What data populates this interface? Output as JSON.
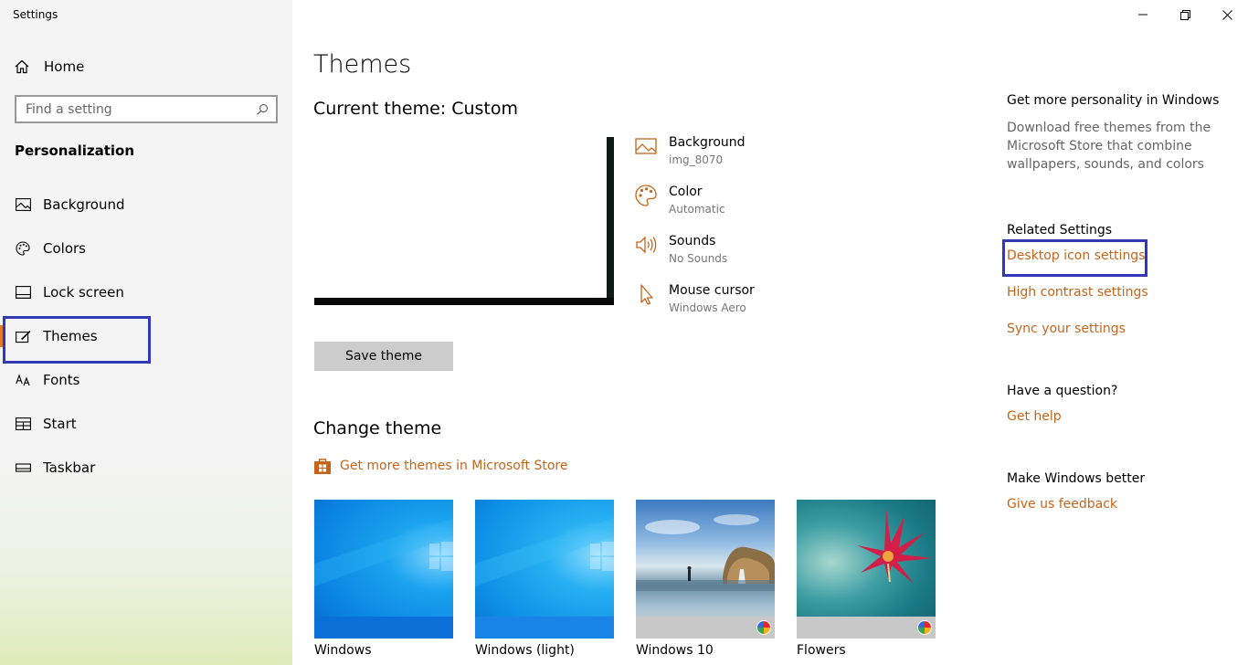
{
  "window": {
    "title": "Settings",
    "controls": {
      "minimize": "—",
      "restore": "restore",
      "close": "close"
    }
  },
  "sidebar": {
    "home_label": "Home",
    "search": {
      "placeholder": "Find a setting"
    },
    "section_title": "Personalization",
    "items": [
      {
        "label": "Background",
        "icon": "background-icon"
      },
      {
        "label": "Colors",
        "icon": "palette-icon"
      },
      {
        "label": "Lock screen",
        "icon": "lock-screen-icon"
      },
      {
        "label": "Themes",
        "icon": "themes-icon",
        "selected": true
      },
      {
        "label": "Fonts",
        "icon": "fonts-icon"
      },
      {
        "label": "Start",
        "icon": "start-icon"
      },
      {
        "label": "Taskbar",
        "icon": "taskbar-icon"
      }
    ]
  },
  "main": {
    "title": "Themes",
    "current_theme": "Current theme: Custom",
    "properties": [
      {
        "name": "Background",
        "value": "img_8070",
        "icon": "picture-icon"
      },
      {
        "name": "Color",
        "value": "Automatic",
        "icon": "palette-icon"
      },
      {
        "name": "Sounds",
        "value": "No Sounds",
        "icon": "speaker-icon"
      },
      {
        "name": "Mouse cursor",
        "value": "Windows Aero",
        "icon": "cursor-icon"
      }
    ],
    "save_button": "Save theme",
    "change_theme": "Change theme",
    "store_link": "Get more themes in Microsoft Store",
    "themes": [
      {
        "name": "Windows"
      },
      {
        "name": "Windows (light)"
      },
      {
        "name": "Windows 10"
      },
      {
        "name": "Flowers"
      }
    ]
  },
  "right": {
    "personality_heading": "Get more personality in Windows",
    "personality_text": "Download free themes from the Microsoft Store that combine wallpapers, sounds, and colors",
    "related_heading": "Related Settings",
    "related_links": [
      "Desktop icon settings",
      "High contrast settings",
      "Sync your settings"
    ],
    "question_heading": "Have a question?",
    "question_link": "Get help",
    "better_heading": "Make Windows better",
    "better_link": "Give us feedback"
  },
  "colors": {
    "accent": "#c4651c",
    "highlight_box": "#3338b4",
    "selection_bar": "#e27b2c"
  }
}
